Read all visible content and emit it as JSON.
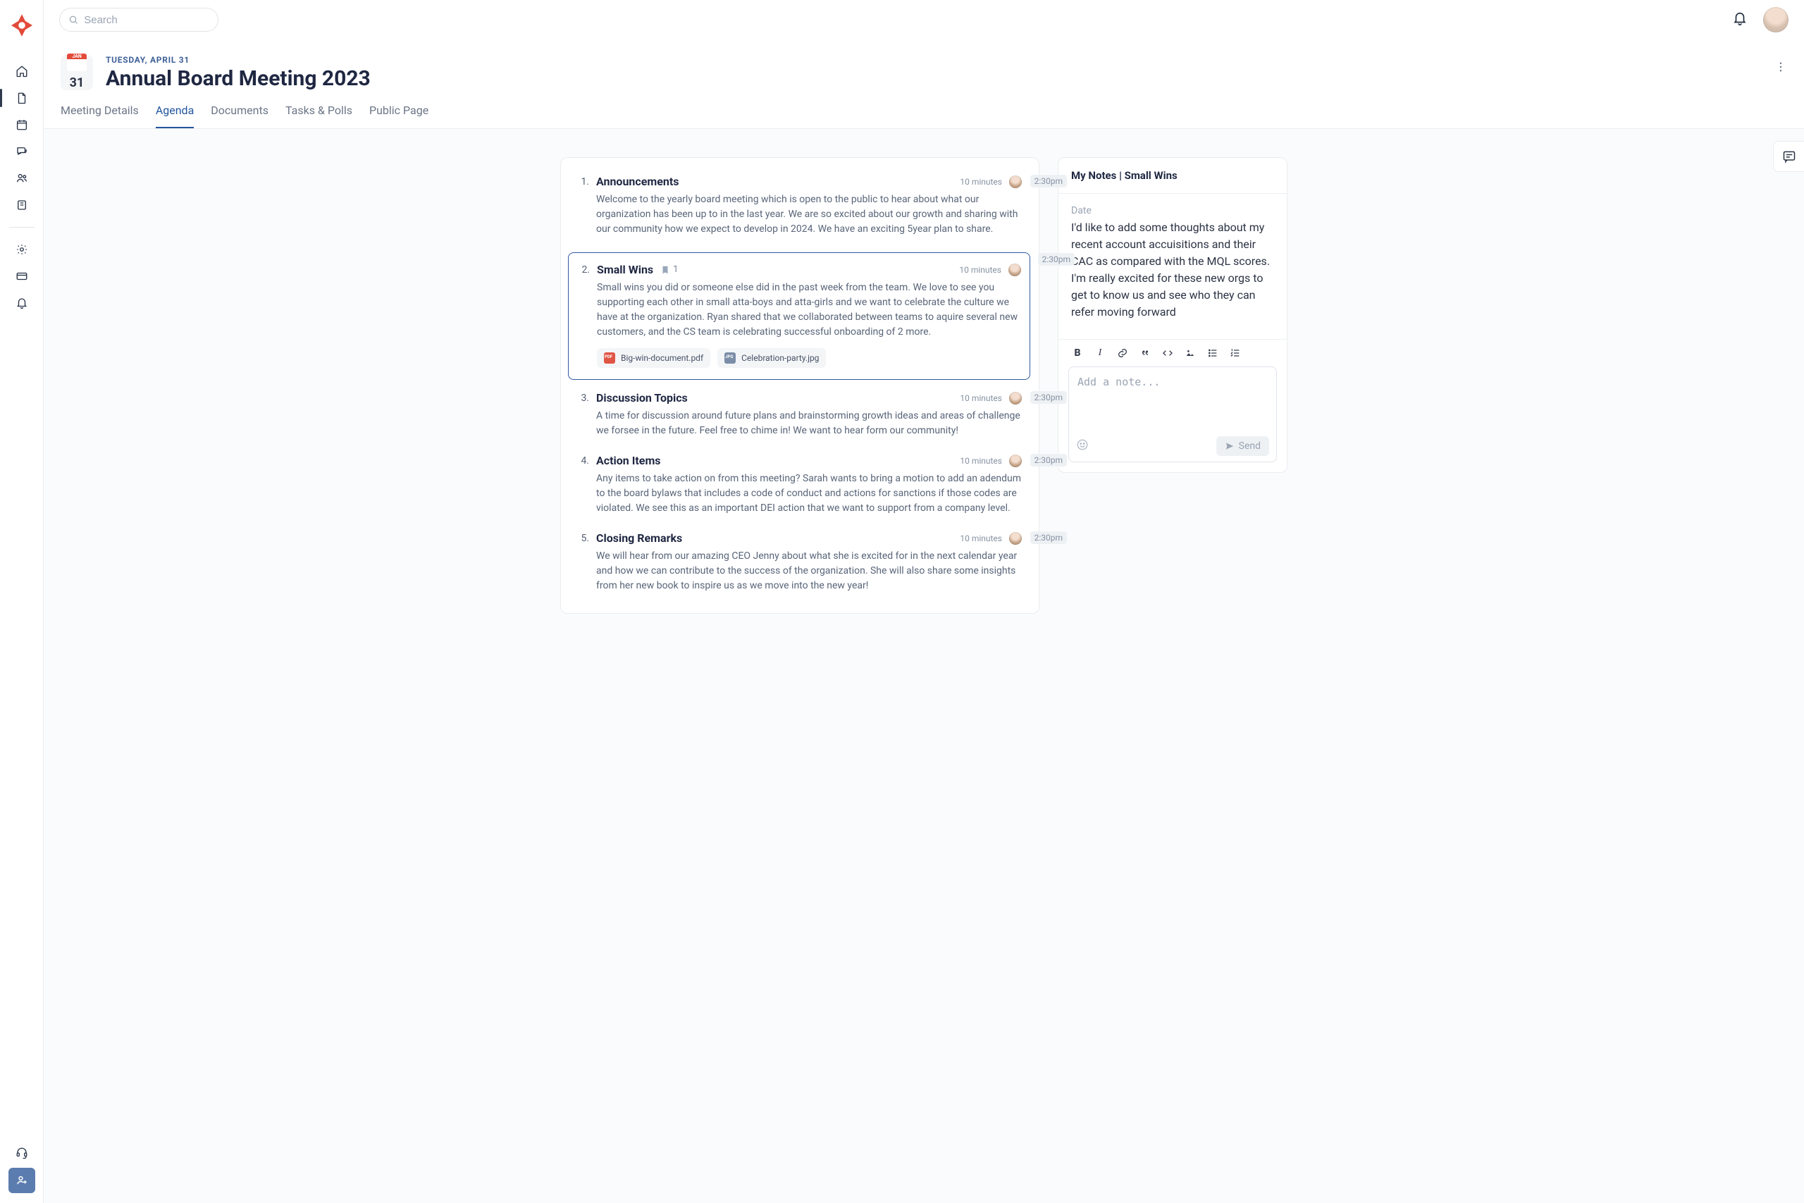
{
  "search": {
    "placeholder": "Search"
  },
  "header": {
    "month": "JAN",
    "day": "31",
    "eyebrow": "TUESDAY, APRIL 31",
    "title": "Annual Board Meeting 2023"
  },
  "tabs": [
    {
      "label": "Meeting Details",
      "active": false
    },
    {
      "label": "Agenda",
      "active": true
    },
    {
      "label": "Documents",
      "active": false
    },
    {
      "label": "Tasks & Polls",
      "active": false
    },
    {
      "label": "Public Page",
      "active": false
    }
  ],
  "agenda": [
    {
      "num": "1.",
      "title": "Announcements",
      "duration": "10 minutes",
      "time": "2:30pm",
      "desc": "Welcome to the yearly board meeting which is open to the public to hear about what our organization has been up to in the last year. We are so excited about our growth and sharing with our community how we expect to develop in 2024. We have an exciting 5year plan to share.",
      "selected": false
    },
    {
      "num": "2.",
      "title": "Small Wins",
      "noteCount": "1",
      "duration": "10 minutes",
      "time": "2:30pm",
      "desc": "Small wins you did or someone else did in the past week from the team. We love to see you supporting each other in small atta-boys and atta-girls and we want to celebrate the culture we have at the organization. Ryan shared that we collaborated between teams to aquire several new customers, and the CS team is celebrating successful onboarding of 2 more.",
      "attachments": [
        {
          "type": "pdf",
          "label": "Big-win-document.pdf"
        },
        {
          "type": "jpg",
          "label": "Celebration-party.jpg"
        }
      ],
      "selected": true
    },
    {
      "num": "3.",
      "title": "Discussion Topics",
      "duration": "10 minutes",
      "time": "2:30pm",
      "desc": "A time for discussion around future plans and brainstorming growth ideas and areas of challenge we forsee in the future. Feel free to chime in! We want to hear form our community!",
      "selected": false
    },
    {
      "num": "4.",
      "title": "Action Items",
      "duration": "10 minutes",
      "time": "2:30pm",
      "desc": "Any items to take action on from this meeting? Sarah wants to bring a motion to add an adendum to the board bylaws that includes a code of conduct and actions for sanctions if those codes are violated. We see this as an important DEI action that we want to support from a company level.",
      "selected": false
    },
    {
      "num": "5.",
      "title": "Closing Remarks",
      "duration": "10 minutes",
      "time": "2:30pm",
      "desc": "We will hear from our amazing CEO Jenny about what she is excited for in the next calendar year and how we can contribute to the success of the organization. She will also share some insights from her new book to inspire us as we move into the new year!",
      "selected": false
    }
  ],
  "notes": {
    "title": "My Notes | Small Wins",
    "dateLabel": "Date",
    "body": "I'd like to add some thoughts about my recent account accuisitions and their CAC as compared with the MQL scores. I'm really excited for these new orgs to get to know us and see who they can refer moving forward",
    "composerPlaceholder": "Add a note...",
    "send": "Send"
  }
}
